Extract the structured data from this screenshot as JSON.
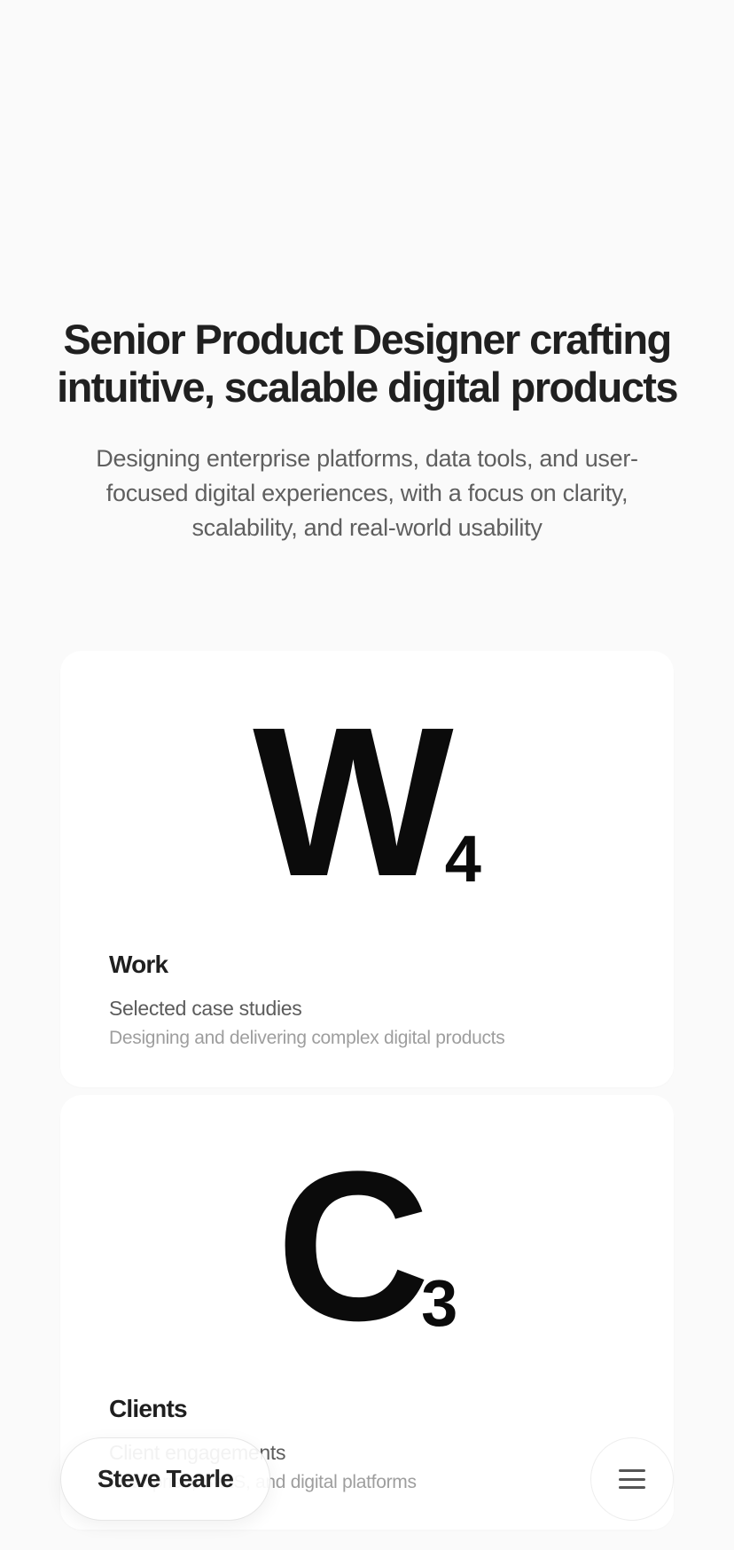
{
  "hero": {
    "headline": "Senior Product Designer crafting intuitive, scalable digital products",
    "description": "Designing enterprise platforms, data tools, and user-focused digital experiences, with a focus on clarity, scalability, and real-world usability"
  },
  "sections": [
    {
      "letter": "W",
      "count": "4",
      "title": "Work",
      "subtitle": "Selected case studies",
      "description": "Designing and delivering complex digital products"
    },
    {
      "letter": "C",
      "count": "3",
      "title": "Clients",
      "subtitle": "Client engagements",
      "description": "Enterprise, SaaS, and digital platforms"
    }
  ],
  "footer": {
    "name": "Steve Tearle",
    "menu_icon": "hamburger-menu-icon"
  },
  "colors": {
    "background": "#fafafa",
    "card": "#ffffff",
    "text_primary": "#222222",
    "text_secondary": "#5f5f5f",
    "text_muted": "#9e9e9e"
  }
}
